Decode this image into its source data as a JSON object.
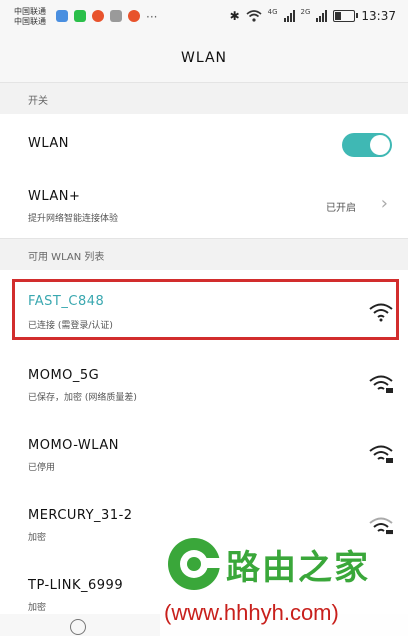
{
  "status_bar": {
    "carrier_lines": [
      "中国联通",
      "中国联通"
    ],
    "more": "···",
    "net1": "4G",
    "net2": "2G",
    "time": "13:37"
  },
  "header": {
    "title": "WLAN"
  },
  "sections": {
    "switch_label": "开关",
    "available_label": "可用 WLAN 列表"
  },
  "wlan_toggle": {
    "label": "WLAN",
    "on": true
  },
  "wlan_plus": {
    "label": "WLAN+",
    "sub": "提升网络智能连接体验",
    "status": "已开启"
  },
  "networks": [
    {
      "name": "FAST_C848",
      "status": "已连接 (需登录/认证)",
      "signal_icon": "wifi-icon"
    },
    {
      "name": "MOMO_5G",
      "status": "已保存，加密 (网络质量差)",
      "signal_icon": "wifi-lock-icon"
    },
    {
      "name": "MOMO-WLAN",
      "status": "已停用",
      "signal_icon": "wifi-lock-icon"
    },
    {
      "name": "MERCURY_31-2",
      "status": "加密",
      "signal_icon": "wifi-lock-icon"
    },
    {
      "name": "TP-LINK_6999",
      "status": "加密",
      "signal_icon": "wifi-lock-icon"
    }
  ],
  "watermark": {
    "brand": "路由之家",
    "url": "(www.hhhyh.com)"
  },
  "colors": {
    "accent": "#3fb8b4",
    "connected_text": "#3aa8b0",
    "highlight_border": "#d22d2d"
  }
}
